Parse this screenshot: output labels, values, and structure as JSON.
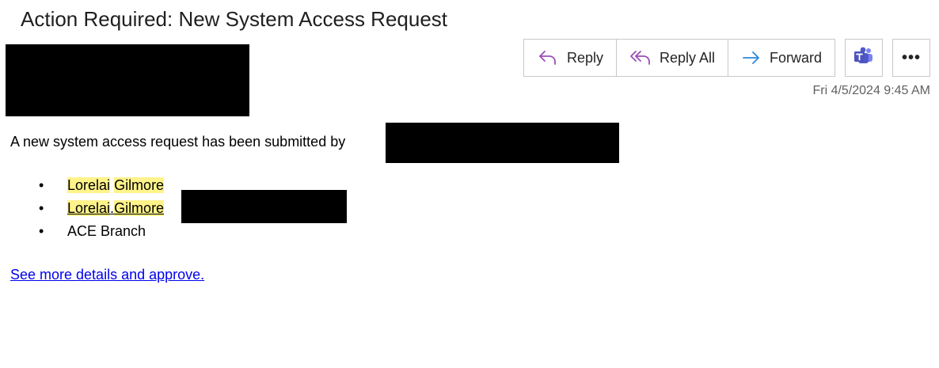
{
  "email": {
    "subject": "Action Required: New System Access Request",
    "date": "Fri 4/5/2024 9:45 AM"
  },
  "toolbar": {
    "reply_label": "Reply",
    "reply_all_label": "Reply All",
    "forward_label": "Forward",
    "more_label": "•••",
    "reply_icon": "reply-icon",
    "reply_all_icon": "reply-all-icon",
    "forward_icon": "forward-icon",
    "teams_icon": "teams-icon",
    "colors": {
      "reply_icon": "#9b4fb8",
      "forward_icon": "#2b88d8",
      "teams": "#5059c9"
    }
  },
  "body": {
    "intro": "A new system access request has been submitted by",
    "bullets": {
      "name_first": "Lorelai",
      "name_last": "Gilmore",
      "email_first": "Lorelai",
      "email_dot": ".",
      "email_last": "Gilmore",
      "branch": "ACE Branch"
    },
    "bullet_char": "•",
    "link": "See more details and approve.",
    "highlight_color": "#fff38a",
    "link_color": "#0000ee"
  }
}
